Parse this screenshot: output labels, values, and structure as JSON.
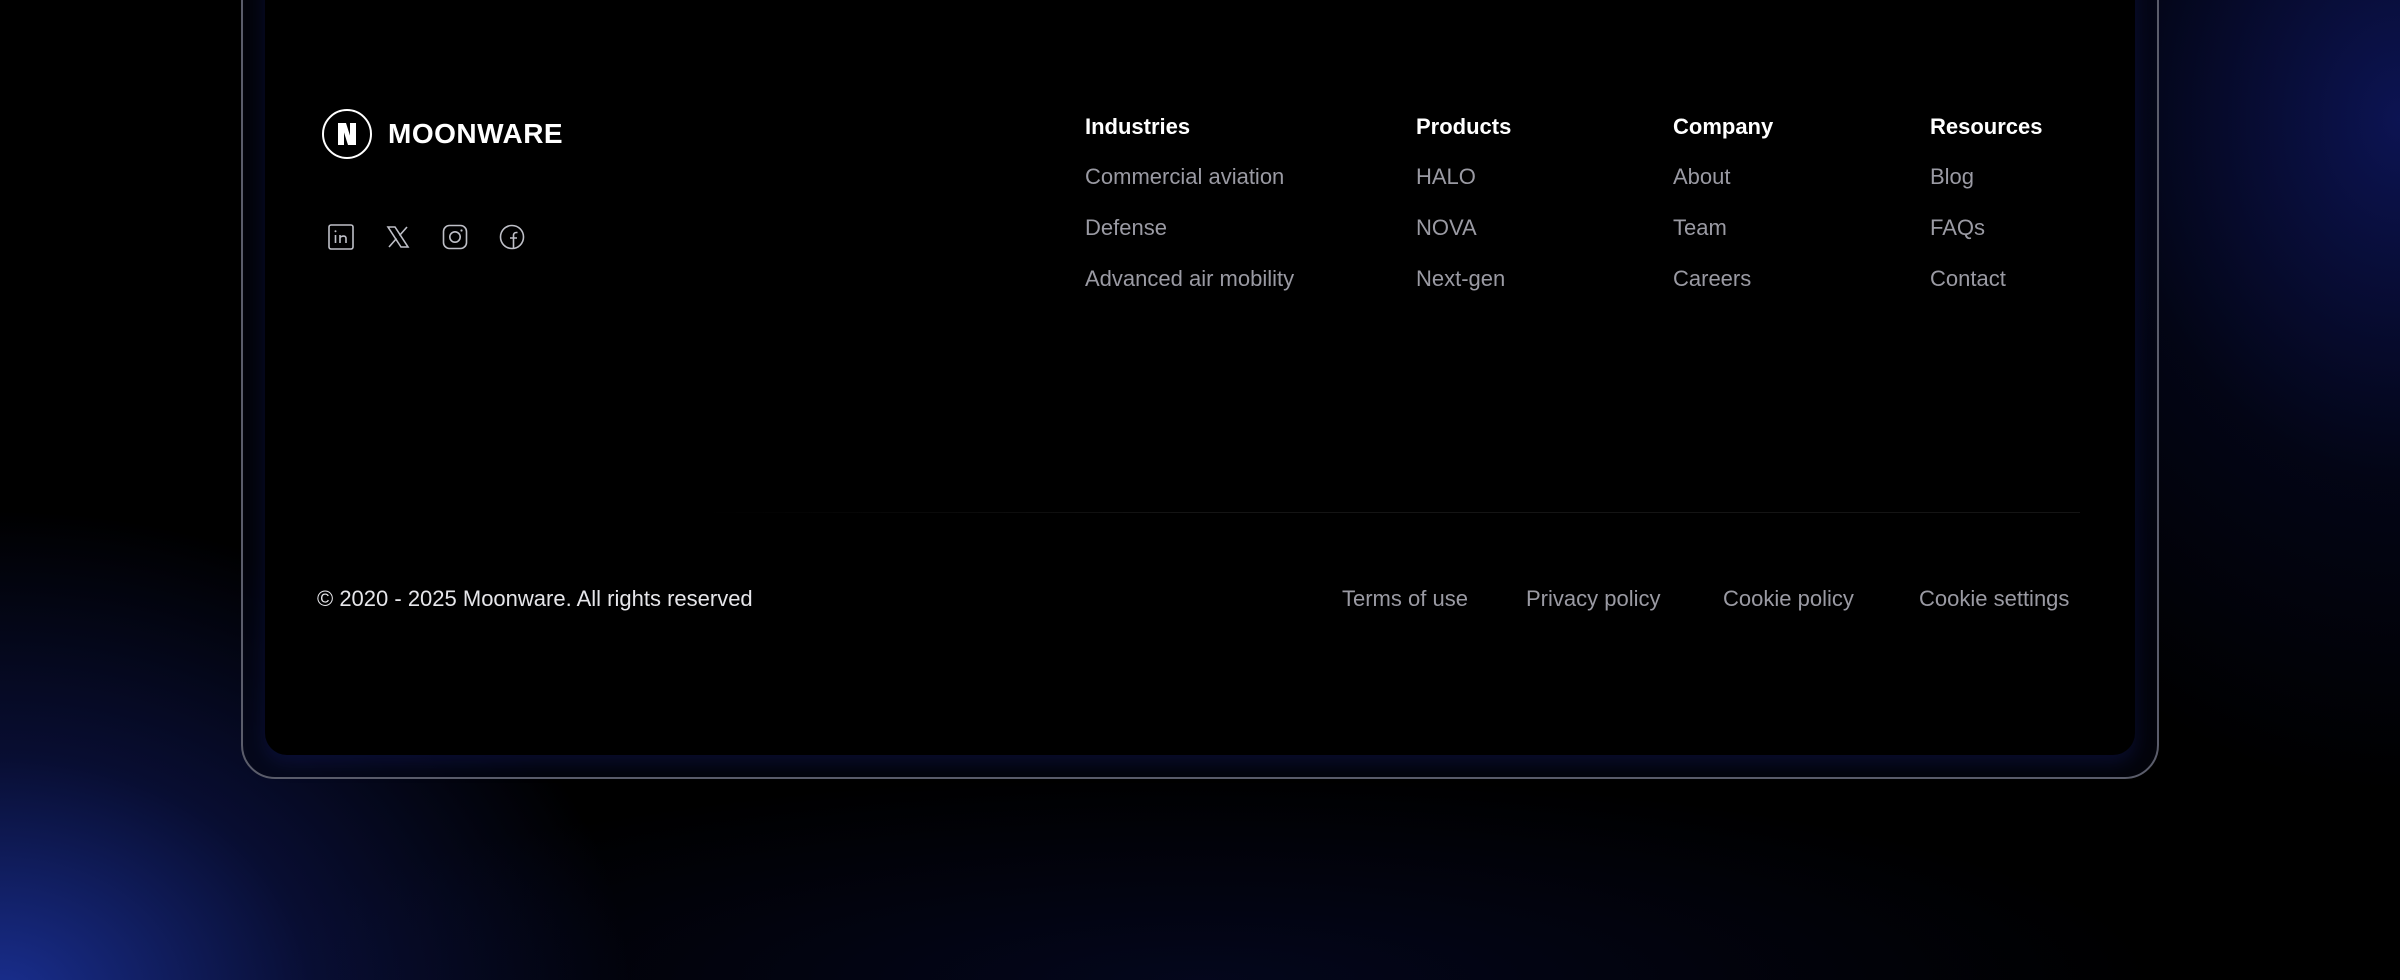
{
  "brand": {
    "name": "MOONWARE",
    "logo_icon": "moonware-logo-icon"
  },
  "socials": [
    {
      "name": "linkedin-icon"
    },
    {
      "name": "x-twitter-icon"
    },
    {
      "name": "instagram-icon"
    },
    {
      "name": "facebook-icon"
    }
  ],
  "nav": {
    "industries": {
      "heading": "Industries",
      "links": [
        "Commercial aviation",
        "Defense",
        "Advanced air mobility"
      ]
    },
    "products": {
      "heading": "Products",
      "links": [
        "HALO",
        "NOVA",
        "Next-gen"
      ]
    },
    "company": {
      "heading": "Company",
      "links": [
        "About",
        "Team",
        "Careers"
      ]
    },
    "resources": {
      "heading": "Resources",
      "links": [
        "Blog",
        "FAQs",
        "Contact"
      ]
    }
  },
  "footer": {
    "copyright": "© 2020 - 2025 Moonware. All rights reserved",
    "terms": "Terms of use",
    "privacy": "Privacy policy",
    "cookie_policy": "Cookie policy",
    "cookie_settings": "Cookie settings"
  },
  "colors": {
    "background": "#000000",
    "glow": "#1e37aa",
    "link": "#9a9aa3",
    "heading": "#ffffff"
  }
}
